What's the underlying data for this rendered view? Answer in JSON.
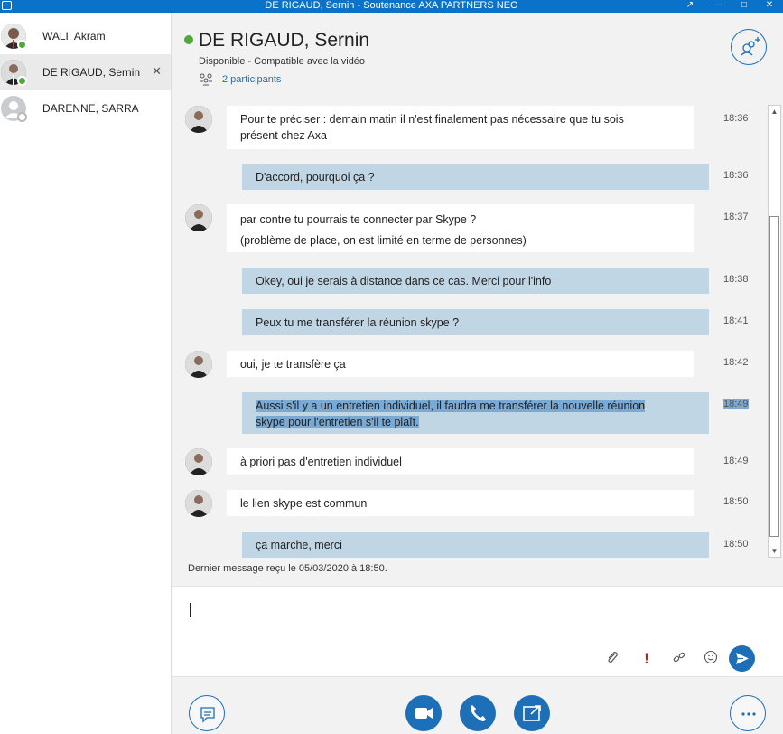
{
  "window": {
    "title": "DE RIGAUD, Sernin - Soutenance AXA PARTNERS NEO"
  },
  "sidebar": {
    "contacts": [
      {
        "name": "WALI, Akram",
        "presence": "available"
      },
      {
        "name": "DE RIGAUD, Sernin",
        "presence": "available",
        "close": "✕"
      },
      {
        "name": "DARENNE, SARRA",
        "presence": "offline"
      }
    ]
  },
  "header": {
    "name": "DE RIGAUD, Sernin",
    "status": "Disponible - Compatible avec la vidéo",
    "participants": "2 participants"
  },
  "messages": [
    {
      "from": "them",
      "lines": [
        "Pour te préciser : demain matin il n'est finalement pas nécessaire que tu sois",
        "présent chez Axa"
      ],
      "time": "18:36"
    },
    {
      "from": "me",
      "lines": [
        "D'accord, pourquoi ça ?"
      ],
      "time": "18:36"
    },
    {
      "from": "them",
      "lines": [
        "par contre tu pourrais te connecter par Skype ?",
        "(problème de place, on est limité en terme de personnes)"
      ],
      "time": "18:37"
    },
    {
      "from": "me",
      "lines": [
        "Okey, oui je serais à distance dans ce cas. Merci pour l'info"
      ],
      "time": "18:38"
    },
    {
      "from": "me",
      "lines": [
        "Peux tu me transférer la réunion skype ?"
      ],
      "time": "18:41"
    },
    {
      "from": "them",
      "lines": [
        "oui, je te transfère ça"
      ],
      "time": "18:42"
    },
    {
      "from": "me",
      "lines": [
        "Aussi s'il y a un entretien individuel, il faudra me transférer la nouvelle réunion",
        "skype pour l'entretien s'il te plaît."
      ],
      "time": "18:49",
      "selected": true
    },
    {
      "from": "them",
      "lines": [
        "à priori pas d'entretien individuel"
      ],
      "time": "18:49"
    },
    {
      "from": "them",
      "lines": [
        "le lien skype est commun"
      ],
      "time": "18:50"
    },
    {
      "from": "me",
      "lines": [
        "ça marche, merci"
      ],
      "time": "18:50"
    }
  ],
  "last_message": "Dernier message reçu le 05/03/2020 à 18:50.",
  "compose": {
    "important_glyph": "!"
  },
  "colors": {
    "accent": "#1d6fb8",
    "presence": "#4fa83d",
    "my_bubble": "#c1d6e4",
    "selection": "#7aa9d3"
  }
}
